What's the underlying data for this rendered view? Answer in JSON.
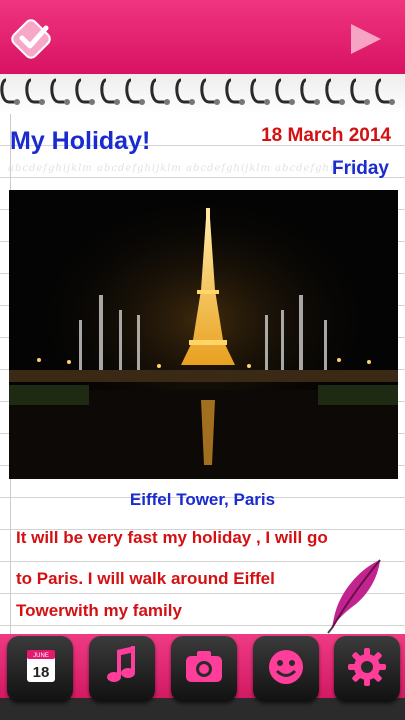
{
  "entry": {
    "title": "My Holiday!",
    "date": "18 March 2014",
    "day": "Friday",
    "photo_caption": "Eiffel Tower, Paris",
    "note_lines": [
      "It will be very fast my holiday , I will go",
      "to Paris. I will walk around Eiffel",
      "Towerwith my family"
    ],
    "watermark": "abcdefghijklm abcdefghijklm abcdefghijklm abcdefghijklm"
  },
  "dock": {
    "calendar_month": "JUNE",
    "calendar_day": "18",
    "buttons": [
      "calendar-icon",
      "music-note-icon",
      "camera-icon",
      "emoji-icon",
      "gear-icon"
    ]
  },
  "colors": {
    "accent": "#e3186e",
    "title": "#1a2bd0",
    "note": "#d41012"
  }
}
